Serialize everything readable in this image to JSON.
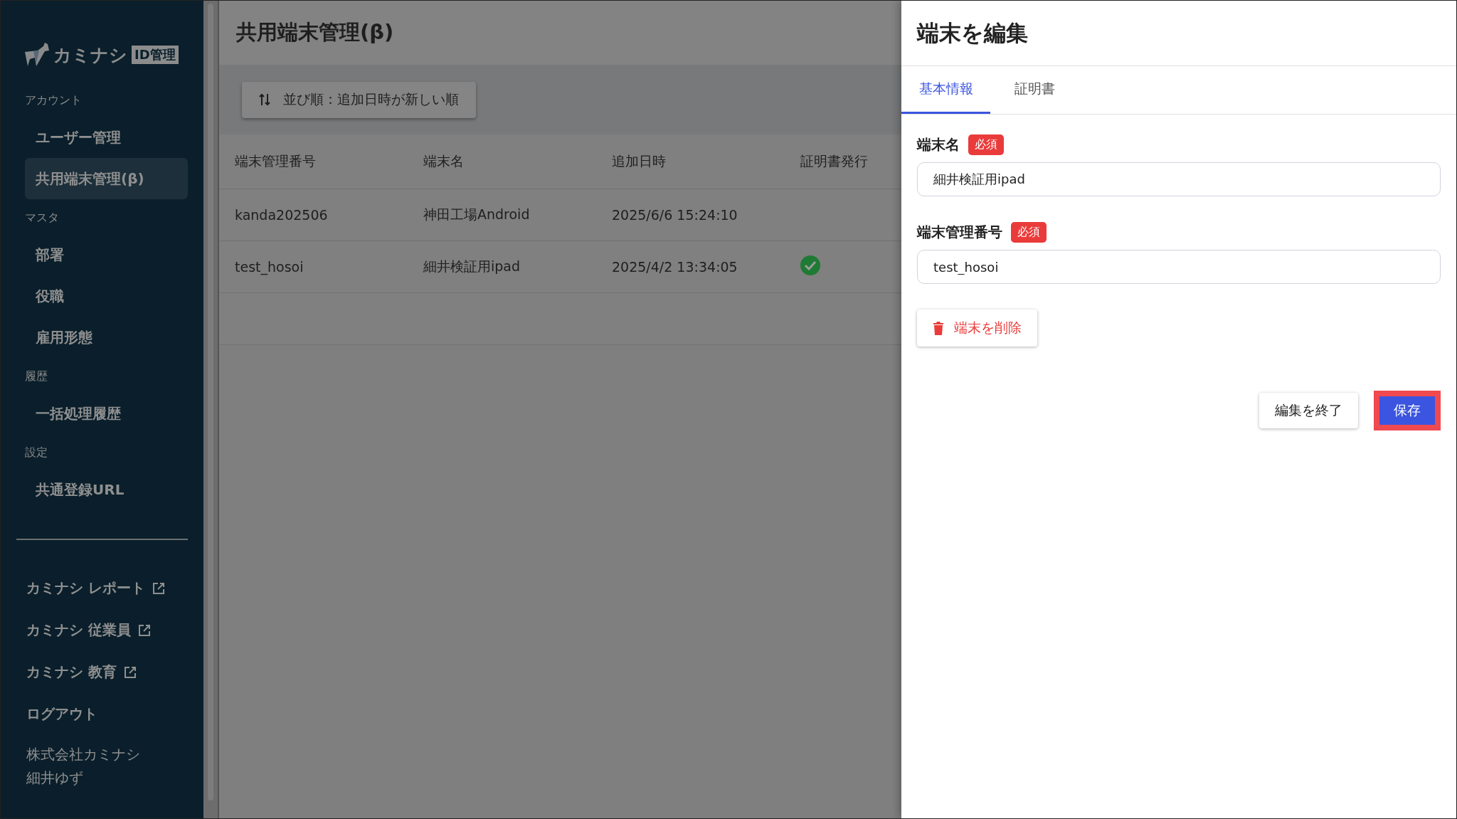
{
  "sidebar": {
    "logo": {
      "name": "カミナシ",
      "badge": "ID管理"
    },
    "sections": [
      {
        "heading": "アカウント",
        "items": [
          {
            "label": "ユーザー管理",
            "selected": false
          },
          {
            "label": "共用端末管理(β)",
            "selected": true
          }
        ]
      },
      {
        "heading": "マスタ",
        "items": [
          {
            "label": "部署",
            "selected": false
          },
          {
            "label": "役職",
            "selected": false
          },
          {
            "label": "雇用形態",
            "selected": false
          }
        ]
      },
      {
        "heading": "履歴",
        "items": [
          {
            "label": "一括処理履歴",
            "selected": false
          }
        ]
      },
      {
        "heading": "設定",
        "items": [
          {
            "label": "共通登録URL",
            "selected": false
          }
        ]
      }
    ],
    "links": [
      {
        "label": "カミナシ レポート",
        "kind": "external"
      },
      {
        "label": "カミナシ 従業員",
        "kind": "external"
      },
      {
        "label": "カミナシ 教育",
        "kind": "external"
      },
      {
        "label": "ログアウト",
        "kind": "action"
      }
    ],
    "company": "株式会社カミナシ",
    "user": "細井ゆず"
  },
  "main": {
    "title": "共用端末管理(β)",
    "sort_button": "並び順：追加日時が新しい順",
    "table": {
      "columns": [
        "端末管理番号",
        "端末名",
        "追加日時",
        "証明書発行"
      ],
      "rows": [
        {
          "cells": [
            "kanda202506",
            "神田工場Android",
            "2025/6/6 15:24:10"
          ],
          "certificate_issued": false
        },
        {
          "cells": [
            "test_hosoi",
            "細井検証用ipad",
            "2025/4/2 13:34:05"
          ],
          "certificate_issued": true
        }
      ]
    }
  },
  "panel": {
    "title": "端末を編集",
    "tabs": [
      {
        "label": "基本情報",
        "selected": true
      },
      {
        "label": "証明書",
        "selected": false
      }
    ],
    "fields": [
      {
        "label": "端末名",
        "badge": "必須",
        "value": "細井検証用ipad"
      },
      {
        "label": "端末管理番号",
        "badge": "必須",
        "value": "test_hosoi"
      }
    ],
    "delete_button": "端末を削除",
    "cancel_button": "編集を終了",
    "save_button": "保存"
  }
}
